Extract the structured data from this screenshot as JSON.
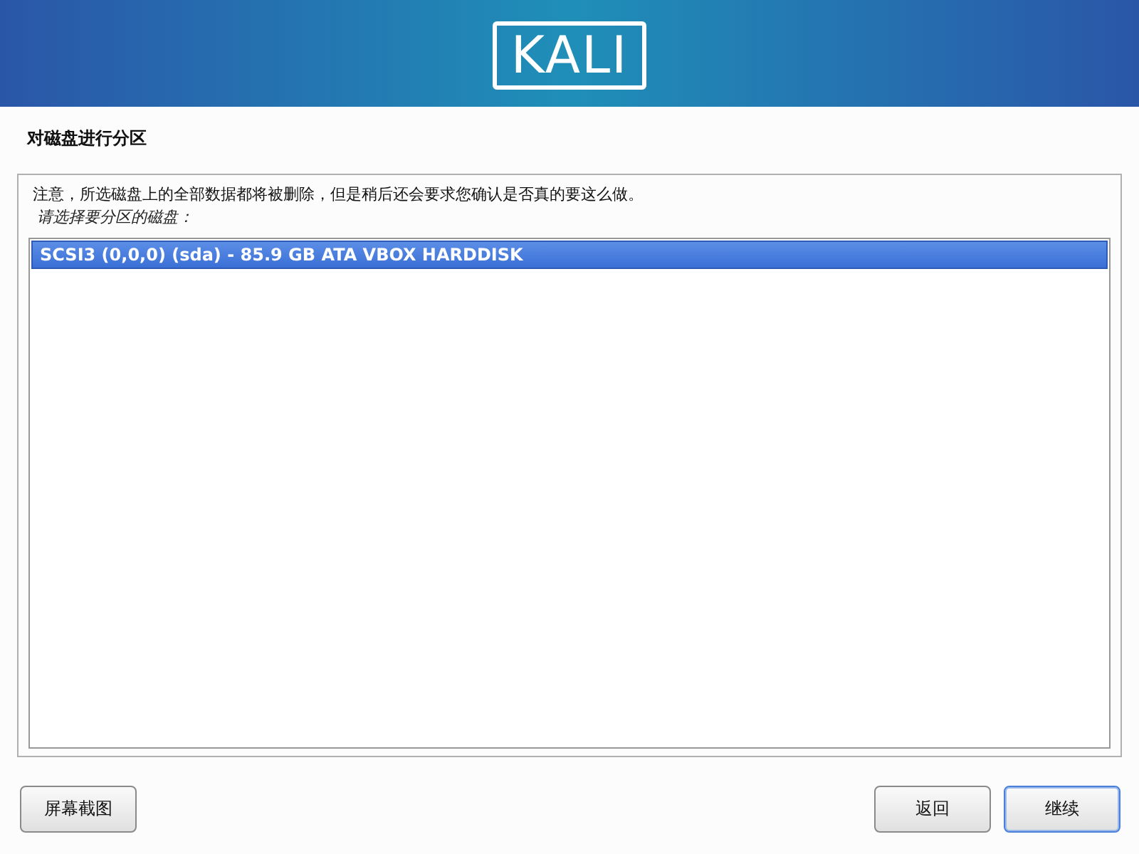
{
  "header": {
    "logo": "KALI"
  },
  "title": "对磁盘进行分区",
  "notice": "注意，所选磁盘上的全部数据都将被删除，但是稍后还会要求您确认是否真的要这么做。",
  "prompt": "请选择要分区的磁盘：",
  "disks": [
    {
      "label": "SCSI3 (0,0,0) (sda) - 85.9 GB ATA VBOX HARDDISK",
      "selected": true
    }
  ],
  "buttons": {
    "screenshot": "屏幕截图",
    "back": "返回",
    "continue": {
      "label": "继续",
      "focused": true
    }
  }
}
